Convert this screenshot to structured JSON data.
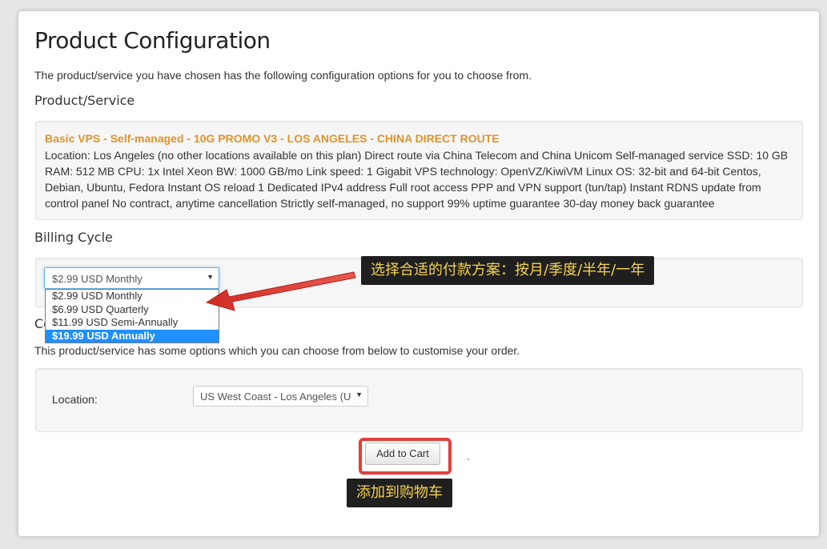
{
  "page": {
    "title": "Product Configuration",
    "intro": "The product/service you have chosen has the following configuration options for you to choose from."
  },
  "product": {
    "heading": "Product/Service",
    "name": "Basic VPS - Self-managed - 10G PROMO V3 - LOS ANGELES - CHINA DIRECT ROUTE",
    "description": "Location: Los Angeles (no other locations available on this plan) Direct route via China Telecom and China Unicom Self-managed service SSD: 10 GB RAM: 512 MB CPU: 1x Intel Xeon BW: 1000 GB/mo Link speed: 1 Gigabit VPS technology: OpenVZ/KiwiVM Linux OS: 32-bit and 64-bit Centos, Debian, Ubuntu, Fedora Instant OS reload 1 Dedicated IPv4 address Full root access PPP and VPN support (tun/tap) Instant RDNS update from control panel No contract, anytime cancellation Strictly self-managed, no support 99% uptime guarantee 30-day money back guarantee"
  },
  "billing": {
    "heading": "Billing Cycle",
    "selected": "$2.99 USD Monthly",
    "options": [
      "$2.99 USD Monthly",
      "$6.99 USD Quarterly",
      "$11.99 USD Semi-Annually",
      "$19.99 USD Annually"
    ],
    "highlighted_option": "$19.99 USD Annually"
  },
  "configurable": {
    "heading_visible": "Co",
    "text": "This product/service has some options which you can choose from below to customise your order.",
    "location_label": "Location:",
    "location_value": "US West Coast - Los Angeles (U"
  },
  "actions": {
    "add_to_cart": "Add to Cart"
  },
  "annotations": {
    "billing_note": "选择合适的付款方案：按月/季度/半年/一年",
    "cart_note": "添加到购物车"
  },
  "colors": {
    "accent": "#e0932a",
    "highlight_red": "#e0403a",
    "dropdown_selected": "#1e90ff",
    "note_bg": "#1f1f1f",
    "note_text": "#f6d34a"
  }
}
